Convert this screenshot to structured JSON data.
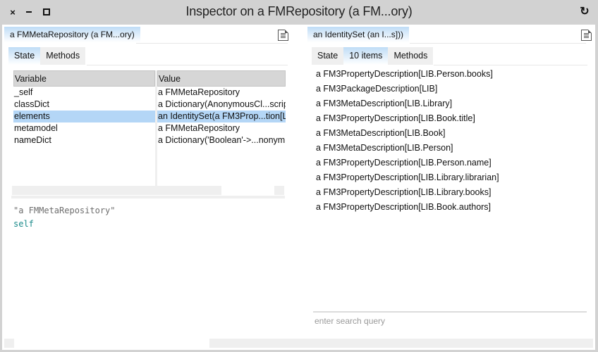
{
  "window": {
    "title": "Inspector on a FMRepository (a FM...ory)",
    "close_icon": "×",
    "menu_icon": "↻"
  },
  "left_pane": {
    "tab_label": "a FMMetaRepository (a FM...ory)",
    "subtabs": [
      {
        "label": "State",
        "active": true
      },
      {
        "label": "Methods",
        "active": false
      }
    ],
    "table": {
      "headers": {
        "variable": "Variable",
        "value": "Value"
      },
      "rows": [
        {
          "variable": "_self",
          "value": "a FMMetaRepository",
          "selected": false
        },
        {
          "variable": "classDict",
          "value": "a Dictionary(AnonymousCl...scrip",
          "selected": false
        },
        {
          "variable": "elements",
          "value": "an IdentitySet(a FM3Prop...tion[L",
          "selected": true
        },
        {
          "variable": "metamodel",
          "value": "a FMMetaRepository",
          "selected": false
        },
        {
          "variable": "nameDict",
          "value": "a Dictionary('Boolean'->...nonym",
          "selected": false
        }
      ]
    },
    "code": {
      "comment": "\"a FMMetaRepository\"",
      "expression": "self"
    }
  },
  "right_pane": {
    "tab_label": "an IdentitySet (an I...s]))",
    "subtabs": [
      {
        "label": "State",
        "active": false
      },
      {
        "label": "10 items",
        "active": true
      },
      {
        "label": "Methods",
        "active": false
      }
    ],
    "items": [
      "a FM3PropertyDescription[LIB.Person.books]",
      "a FM3PackageDescription[LIB]",
      "a FM3MetaDescription[LIB.Library]",
      "a FM3PropertyDescription[LIB.Book.title]",
      "a FM3MetaDescription[LIB.Book]",
      "a FM3MetaDescription[LIB.Person]",
      "a FM3PropertyDescription[LIB.Person.name]",
      "a FM3PropertyDescription[LIB.Library.librarian]",
      "a FM3PropertyDescription[LIB.Library.books]",
      "a FM3PropertyDescription[LIB.Book.authors]"
    ],
    "search": {
      "value": "",
      "placeholder": "enter search query"
    }
  },
  "colors": {
    "selection": "#b4d6f6",
    "tab_active": "#bfdcf6",
    "code_keyword": "#1a8a8a"
  }
}
